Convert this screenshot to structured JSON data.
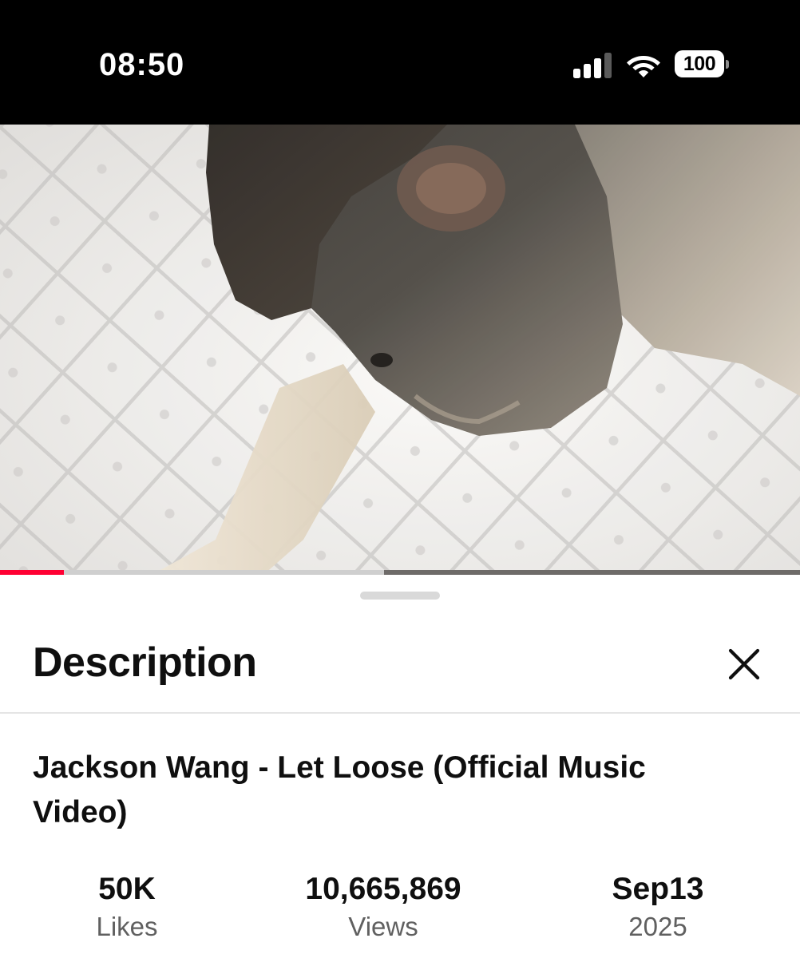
{
  "status_bar": {
    "time": "08:50",
    "battery_level": "100",
    "icons": [
      "cell-signal-icon",
      "wifi-icon",
      "battery-icon"
    ]
  },
  "video": {
    "progress_played_fraction": 0.08,
    "progress_buffered_fraction": 0.48,
    "colors": {
      "progress_played": "#ff0033",
      "progress_buffered": "#cfcfcf",
      "progress_track": "#6e6b69"
    }
  },
  "sheet": {
    "title": "Description",
    "close_icon": "close-icon",
    "video_title": "Jackson Wang - Let Loose (Official Music Video)",
    "stats": {
      "likes_value": "50K",
      "likes_label": "Likes",
      "views_value": "10,665,869",
      "views_label": "Views",
      "date_value": "Sep13",
      "date_year": "2025"
    }
  }
}
